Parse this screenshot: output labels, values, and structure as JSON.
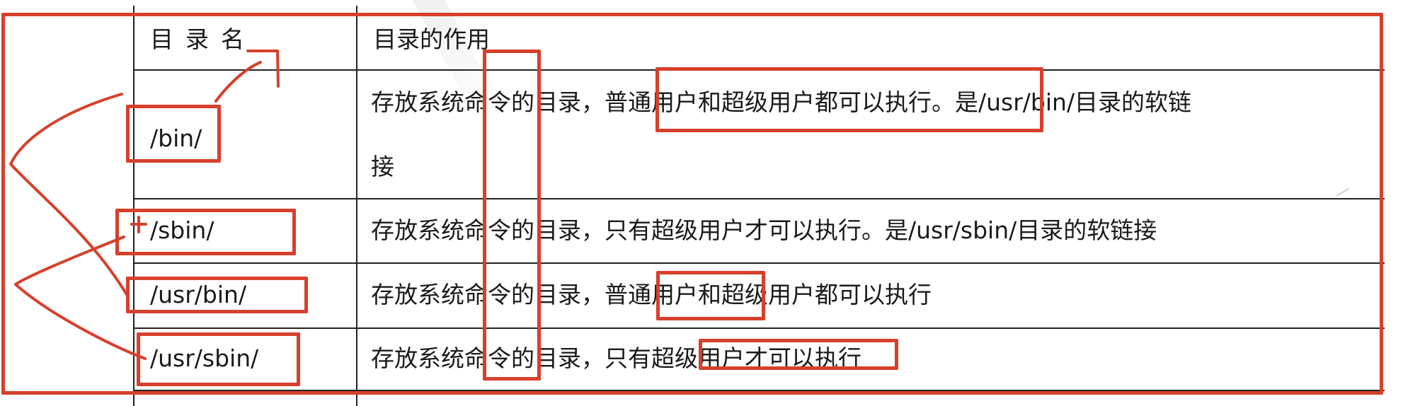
{
  "table": {
    "header": {
      "name": "目录名",
      "purpose": "目录的作用"
    },
    "rows": [
      {
        "name": "/bin/",
        "purpose_line1": "存放系统命令的目录，普通用户和超级用户都可以执行。是/usr/bin/目录的软链",
        "purpose_line2": "接"
      },
      {
        "name": "/sbin/",
        "purpose_line1": "存放系统命令的目录，只有超级用户才可以执行。是/usr/sbin/目录的软链接"
      },
      {
        "name": "/usr/bin/",
        "purpose_line1": "存放系统命令的目录，普通用户和超级用户都可以执行"
      },
      {
        "name": "/usr/sbin/",
        "purpose_line1": "存放系统命令的目录，只有超级用户才可以执行"
      }
    ]
  },
  "annotation_color": "#d6402c"
}
